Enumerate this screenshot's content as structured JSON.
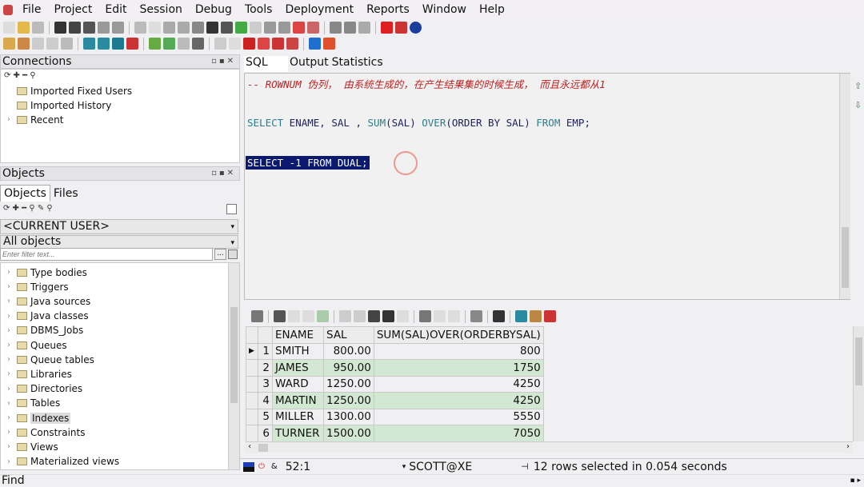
{
  "menu": [
    "File",
    "Project",
    "Edit",
    "Session",
    "Debug",
    "Tools",
    "Deployment",
    "Reports",
    "Window",
    "Help"
  ],
  "connections": {
    "title": "Connections",
    "items": [
      "Imported Fixed Users",
      "Imported History",
      "Recent"
    ]
  },
  "objects": {
    "title": "Objects",
    "tabs": [
      "Objects",
      "Files"
    ],
    "user_select": "<CURRENT USER>",
    "type_select": "All objects",
    "filter_placeholder": "Enter filter text...",
    "filter_button": "...",
    "items": [
      "Type bodies",
      "Triggers",
      "Java sources",
      "Java classes",
      "DBMS_Jobs",
      "Queues",
      "Queue tables",
      "Libraries",
      "Directories",
      "Tables",
      "Indexes",
      "Constraints",
      "Views",
      "Materialized views"
    ],
    "selected": "Indexes"
  },
  "editor_tabs": [
    "SQL",
    "Output",
    "Statistics"
  ],
  "sql": {
    "comment": "-- ROWNUM 伪列， 由系统生成的，在产生结果集的时候生成， 而且永远都从1",
    "line2": [
      "SELECT",
      " ENAME, SAL , ",
      "SUM",
      "(SAL) ",
      "OVER",
      "(ORDER BY SAL) ",
      "FROM",
      " EMP;"
    ],
    "line3": "SELECT -1 FROM DUAL;"
  },
  "grid": {
    "columns": [
      "ENAME",
      "SAL",
      "SUM(SAL)OVER(ORDERBYSAL)"
    ],
    "rows": [
      [
        "1",
        "SMITH",
        "800.00",
        "800"
      ],
      [
        "2",
        "JAMES",
        "950.00",
        "1750"
      ],
      [
        "3",
        "WARD",
        "1250.00",
        "4250"
      ],
      [
        "4",
        "MARTIN",
        "1250.00",
        "4250"
      ],
      [
        "5",
        "MILLER",
        "1300.00",
        "5550"
      ],
      [
        "6",
        "TURNER",
        "1500.00",
        "7050"
      ]
    ]
  },
  "status": {
    "position": "52:1",
    "connection": "SCOTT@XE",
    "message": "12 rows selected in 0.054 seconds"
  },
  "find": "Find",
  "colors": {
    "selection": "#0b1a6e",
    "comment": "#c02020",
    "keyword": "#2a7d8c",
    "row_alt": "#d2e8d2"
  }
}
